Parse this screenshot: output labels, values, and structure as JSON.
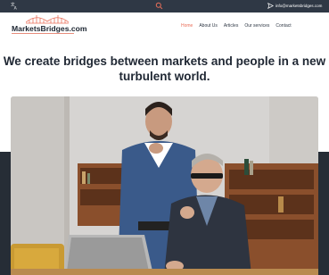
{
  "topbar": {
    "language_icon": "language-icon",
    "search_icon": "search-icon",
    "send_icon": "send-icon",
    "email": "info@marketsbridges.com"
  },
  "header": {
    "logo_text": "MarketsBridges.com",
    "logo_icon": "bridge-icon",
    "nav": [
      {
        "label": "Home",
        "active": true
      },
      {
        "label": "About Us",
        "active": false
      },
      {
        "label": "Articles",
        "active": false
      },
      {
        "label": "Our services",
        "active": false
      },
      {
        "label": "Contact",
        "active": false
      }
    ]
  },
  "hero": {
    "title_line1": "We create bridges between markets and people in a new",
    "title_line2": "turbulent world."
  },
  "colors": {
    "topbar_bg": "#2f3845",
    "accent": "#ea6f5a",
    "text_dark": "#1f2733",
    "dark_band": "#262d36"
  }
}
